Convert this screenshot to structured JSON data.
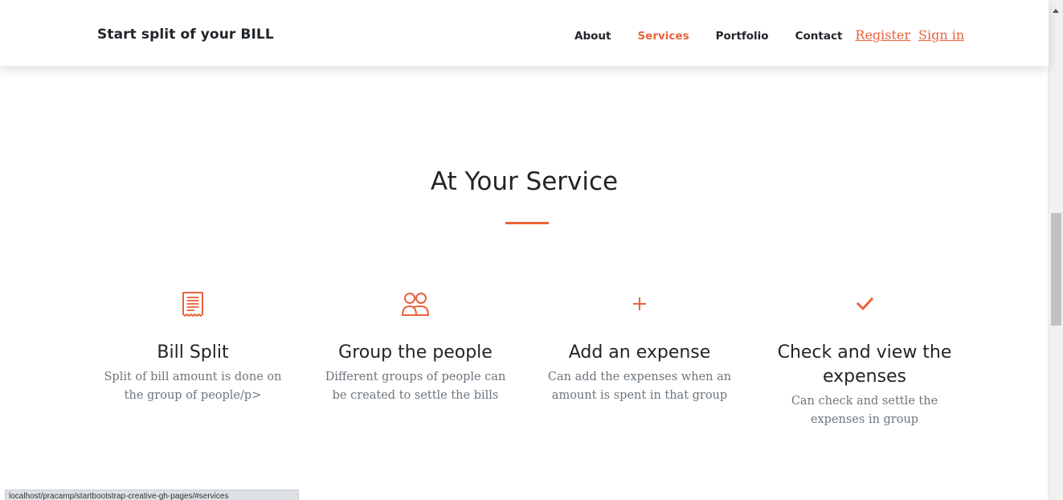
{
  "accent_color": "#e8623b",
  "navbar": {
    "brand": "Start split of your BILL",
    "links": [
      {
        "label": "About"
      },
      {
        "label": "Services"
      },
      {
        "label": "Portfolio"
      },
      {
        "label": "Contact"
      }
    ],
    "active_link": "Services",
    "register": "Register",
    "sign_in": "Sign in"
  },
  "section": {
    "title": "At Your Service"
  },
  "services": [
    {
      "icon": "receipt-icon",
      "title": "Bill Split",
      "description": "Split of bill amount is done on the group of people/p>"
    },
    {
      "icon": "people-icon",
      "title": "Group the people",
      "description": "Different groups of people can be created to settle the bills"
    },
    {
      "icon": "plus-icon",
      "title": "Add an expense",
      "description": "Can add the expenses when an amount is spent in that group"
    },
    {
      "icon": "check-icon",
      "title": "Check and view the expenses",
      "description": "Can check and settle the expenses in group"
    }
  ],
  "status_bar": {
    "url": "localhost/pracamp/startbootstrap-creative-gh-pages/#services"
  }
}
